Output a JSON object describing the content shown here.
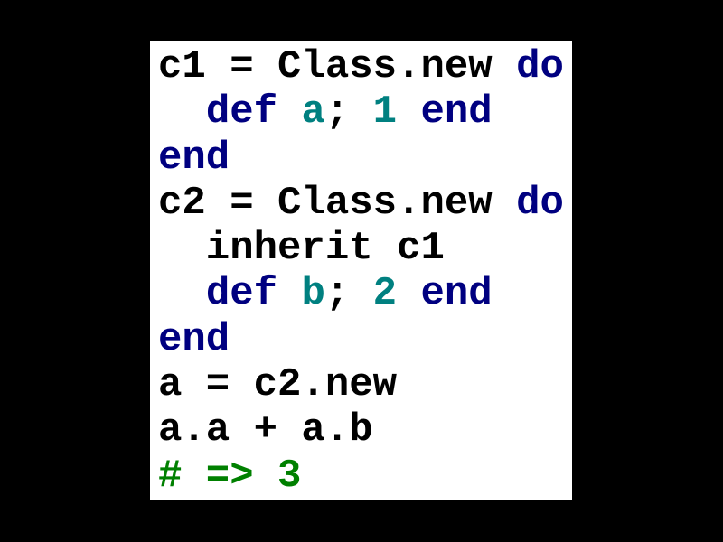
{
  "colors": {
    "background": "#000000",
    "card": "#ffffff",
    "plain": "#000000",
    "keyword": "#000080",
    "identifier": "#008080",
    "number": "#008080",
    "comment": "#008000"
  },
  "code": {
    "lines": [
      [
        {
          "t": "c1 = Class.new ",
          "k": "plain"
        },
        {
          "t": "do",
          "k": "kw"
        }
      ],
      [
        {
          "t": "  ",
          "k": "plain"
        },
        {
          "t": "def",
          "k": "kw"
        },
        {
          "t": " ",
          "k": "plain"
        },
        {
          "t": "a",
          "k": "ident"
        },
        {
          "t": "; ",
          "k": "plain"
        },
        {
          "t": "1",
          "k": "num"
        },
        {
          "t": " ",
          "k": "plain"
        },
        {
          "t": "end",
          "k": "kw"
        }
      ],
      [
        {
          "t": "end",
          "k": "kw"
        }
      ],
      [
        {
          "t": "c2 = Class.new ",
          "k": "plain"
        },
        {
          "t": "do",
          "k": "kw"
        }
      ],
      [
        {
          "t": "  inherit c1",
          "k": "plain"
        }
      ],
      [
        {
          "t": "  ",
          "k": "plain"
        },
        {
          "t": "def",
          "k": "kw"
        },
        {
          "t": " ",
          "k": "plain"
        },
        {
          "t": "b",
          "k": "ident"
        },
        {
          "t": "; ",
          "k": "plain"
        },
        {
          "t": "2",
          "k": "num"
        },
        {
          "t": " ",
          "k": "plain"
        },
        {
          "t": "end",
          "k": "kw"
        }
      ],
      [
        {
          "t": "end",
          "k": "kw"
        }
      ],
      [
        {
          "t": "a = c2.new",
          "k": "plain"
        }
      ],
      [
        {
          "t": "a.a + a.b",
          "k": "plain"
        }
      ],
      [
        {
          "t": "# => 3",
          "k": "cmt"
        }
      ]
    ]
  }
}
